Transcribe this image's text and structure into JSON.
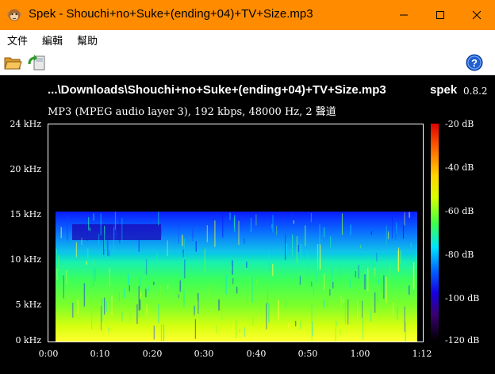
{
  "window": {
    "title": "Spek - Shouchi+no+Suke+(ending+04)+TV+Size.mp3",
    "app_icon": "monkey-face-icon",
    "controls": [
      "minimize-icon",
      "maximize-icon",
      "close-icon"
    ]
  },
  "menu": {
    "file": "文件",
    "edit": "編輯",
    "help": "幫助"
  },
  "toolbar": {
    "open_icon": "folder-open-icon",
    "save_icon": "save-refresh-icon",
    "help_icon": "help-icon"
  },
  "spectrogram": {
    "file_path": "...\\Downloads\\Shouchi+no+Suke+(ending+04)+TV+Size.mp3",
    "app_name": "spek",
    "version": "0.8.2",
    "info": "MP3 (MPEG audio layer 3), 192 kbps, 48000 Hz, 2 聲道",
    "freq_labels": [
      "24 kHz",
      "20 kHz",
      "15 kHz",
      "10 kHz",
      "5 kHz",
      "0 kHz"
    ],
    "time_labels": [
      "0:00",
      "0:10",
      "0:20",
      "0:30",
      "0:40",
      "0:50",
      "1:00",
      "1:12"
    ],
    "db_labels": [
      "-20 dB",
      "-40 dB",
      "-60 dB",
      "-80 dB",
      "-100 dB",
      "-120 dB"
    ],
    "colors": {
      "background": "#000000",
      "title_bar": "#ff8c00",
      "high_energy": "#e6ff00",
      "mid_energy": "#3fff4a",
      "low_energy": "#0050ff",
      "floor": "#1000a0"
    }
  }
}
